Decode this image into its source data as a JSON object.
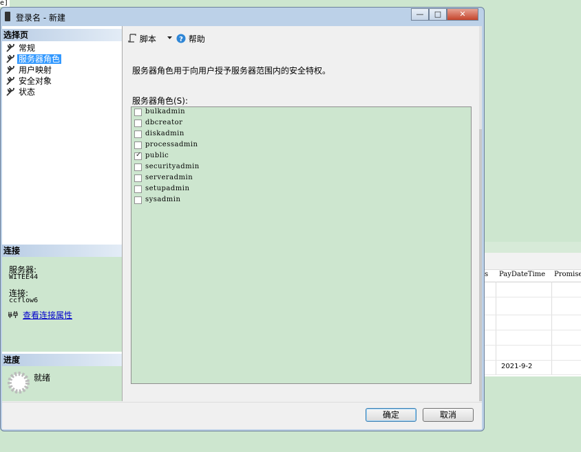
{
  "background": {
    "top_left_text": "e]",
    "grid": {
      "headers": [
        "s",
        "PayDateTime",
        "Promise"
      ],
      "cell_value": "2021-9-2"
    }
  },
  "window": {
    "title": "登录名 - 新建",
    "buttons": {
      "minimize": "—",
      "maximize": "□",
      "close": "✕"
    }
  },
  "left": {
    "select_page_header": "选择页",
    "pages": [
      {
        "label": "常规",
        "icon": "wrench-icon",
        "selected": false
      },
      {
        "label": "服务器角色",
        "icon": "wrench-icon",
        "selected": true
      },
      {
        "label": "用户映射",
        "icon": "wrench-icon",
        "selected": false
      },
      {
        "label": "安全对象",
        "icon": "wrench-icon",
        "selected": false
      },
      {
        "label": "状态",
        "icon": "wrench-icon",
        "selected": false
      }
    ],
    "connection": {
      "header": "连接",
      "server_label": "服务器:",
      "server_value": "WITEE44",
      "connection_label": "连接:",
      "connection_value": "ccflow6",
      "view_properties_link": "查看连接属性"
    },
    "progress": {
      "header": "进度",
      "status": "就绪"
    }
  },
  "right": {
    "toolbar": {
      "script_label": "脚本",
      "help_label": "帮助"
    },
    "description": "服务器角色用于向用户授予服务器范围内的安全特权。",
    "roles_label": "服务器角色(S):",
    "roles": [
      {
        "name": "bulkadmin",
        "checked": false
      },
      {
        "name": "dbcreator",
        "checked": false
      },
      {
        "name": "diskadmin",
        "checked": false
      },
      {
        "name": "processadmin",
        "checked": false
      },
      {
        "name": "public",
        "checked": true
      },
      {
        "name": "securityadmin",
        "checked": false
      },
      {
        "name": "serveradmin",
        "checked": false
      },
      {
        "name": "setupadmin",
        "checked": false
      },
      {
        "name": "sysadmin",
        "checked": false
      }
    ]
  },
  "footer": {
    "ok_label": "确定",
    "cancel_label": "取消"
  },
  "colors": {
    "selection": "#3399ff",
    "pane_green": "#cde6cf",
    "link": "#0000cc"
  }
}
